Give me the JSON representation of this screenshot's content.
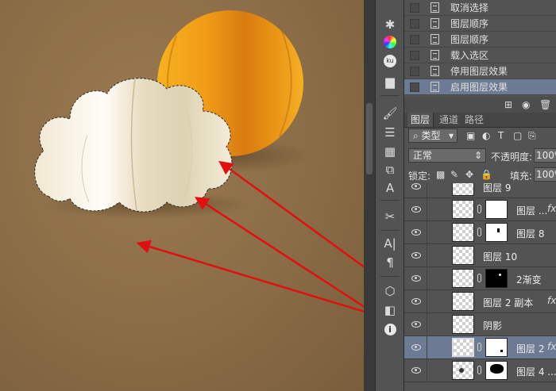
{
  "history": {
    "items": [
      {
        "label": "取消选择",
        "selected": false
      },
      {
        "label": "图层顺序",
        "selected": false
      },
      {
        "label": "图层顺序",
        "selected": false
      },
      {
        "label": "载入选区",
        "selected": false
      },
      {
        "label": "停用图层效果",
        "selected": false
      },
      {
        "label": "启用图层效果",
        "selected": true
      }
    ]
  },
  "layers_panel": {
    "tabs": [
      "图层",
      "通道",
      "路径"
    ],
    "filter_label": "类型",
    "blend_mode": "正常",
    "opacity_label": "不透明度:",
    "opacity_value": "100%",
    "lock_label": "锁定:",
    "fill_label": "填充:",
    "fill_value": "100%",
    "layers": [
      {
        "name": "图层 9",
        "mask": false,
        "fx": false,
        "selected": false
      },
      {
        "name": "图层 ...",
        "mask": true,
        "fx": true,
        "selected": false
      },
      {
        "name": "图层 8",
        "mask": true,
        "fx": false,
        "selected": false
      },
      {
        "name": "图层 10",
        "mask": false,
        "fx": false,
        "selected": false
      },
      {
        "name": "2渐变",
        "mask": true,
        "fx": false,
        "selected": false
      },
      {
        "name": "图层 2 副本",
        "mask": false,
        "fx": true,
        "selected": false
      },
      {
        "name": "阴影",
        "mask": false,
        "fx": false,
        "selected": false
      },
      {
        "name": "图层 2",
        "mask": true,
        "fx": true,
        "selected": true
      },
      {
        "name": "图层 4 ...",
        "mask": true,
        "fx": false,
        "selected": false
      }
    ]
  },
  "icons": {
    "toolbar": [
      "network-icon",
      "color-wheel-icon",
      "ku-icon",
      "histogram-icon",
      "brush-settings-icon",
      "sliders-icon",
      "swatches-icon",
      "clone-source-icon",
      "character-style-icon",
      "tools-icon",
      "character-icon",
      "paragraph-icon",
      "3d-cube-icon",
      "layer-comps-icon",
      "info-icon"
    ],
    "colors": {
      "selection": "#6c7b93",
      "panel": "#535353",
      "arrow": "#e01010",
      "sun": "#f0a820"
    }
  }
}
